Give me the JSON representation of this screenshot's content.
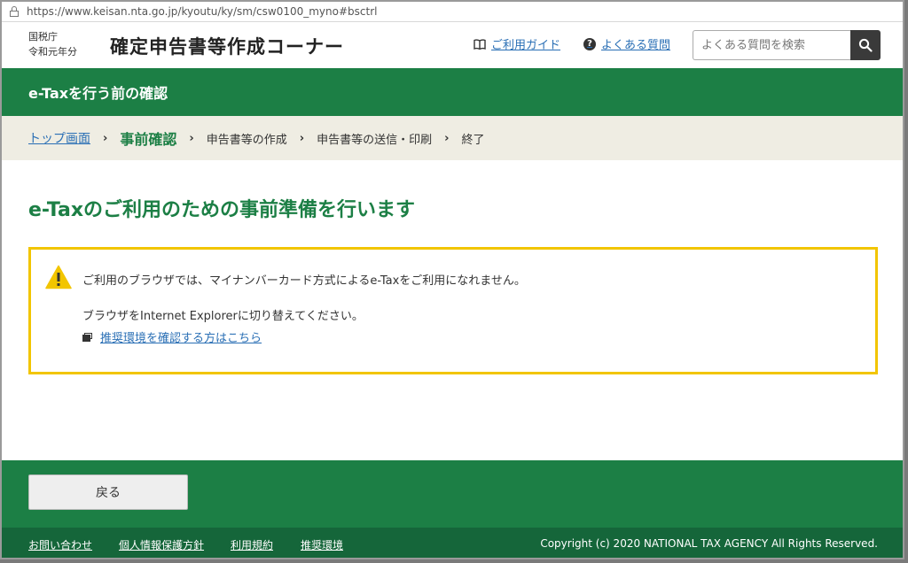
{
  "browser": {
    "url": "https://www.keisan.nta.go.jp/kyoutu/ky/sm/csw0100_myno#bsctrl"
  },
  "header": {
    "agency": "国税庁",
    "year": "令和元年分",
    "title": "確定申告書等作成コーナー",
    "guide_link": "ご利用ガイド",
    "faq_link": "よくある質問",
    "search_placeholder": "よくある質問を検索"
  },
  "band": {
    "title": "e-Taxを行う前の確認"
  },
  "steps": {
    "top": "トップ画面",
    "items": [
      "事前確認",
      "申告書等の作成",
      "申告書等の送信・印刷",
      "終了"
    ],
    "separator": "›"
  },
  "main": {
    "heading": "e-Taxのご利用のための事前準備を行います",
    "notice_line1": "ご利用のブラウザでは、マイナンバーカード方式によるe-Taxをご利用になれません。",
    "notice_line2": "ブラウザをInternet Explorerに切り替えてください。",
    "notice_link": "推奨環境を確認する方はこちら"
  },
  "footer": {
    "back_button": "戻る",
    "links": [
      "お問い合わせ",
      "個人情報保護方針",
      "利用規約",
      "推奨環境"
    ],
    "copyright": "Copyright (c) 2020 NATIONAL TAX AGENCY All Rights Reserved."
  },
  "colors": {
    "brand_green": "#1c7f45",
    "warning_border": "#f2c500",
    "link_blue": "#2a6fb5"
  }
}
